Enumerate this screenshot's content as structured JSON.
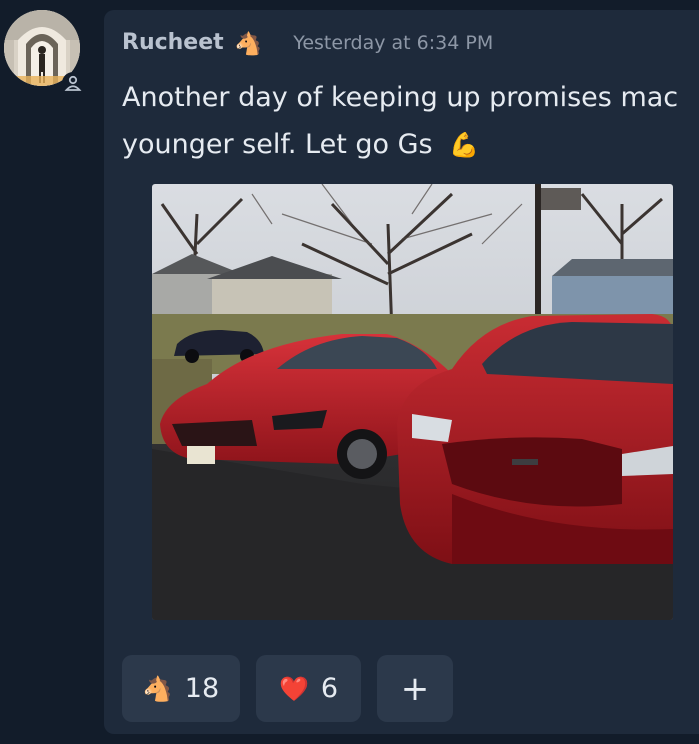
{
  "message": {
    "author": "Rucheet",
    "author_badge_icon": "horse-head-emoji",
    "timestamp": "Yesterday at 6:34 PM",
    "line1": "Another day of keeping up promises mac",
    "line2": "younger self. Let go Gs",
    "line2_emoji": "💪",
    "attachment_icon": "photo-red-mustangs"
  },
  "reactions": [
    {
      "emoji": "🐴",
      "count": "18"
    },
    {
      "emoji": "❤️",
      "count": "6"
    }
  ],
  "add_reaction_label": "+",
  "colors": {
    "background": "#121c2a",
    "card": "#1e2a3b",
    "reaction_bg": "#2c394b",
    "accent_red": "#c8202a"
  }
}
